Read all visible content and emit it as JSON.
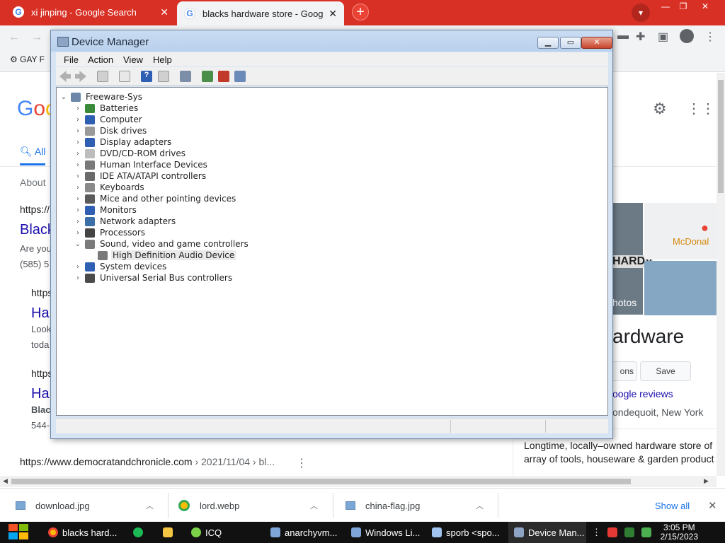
{
  "browser": {
    "tabs": [
      {
        "title": "xi jinping - Google Search",
        "close": "✕"
      },
      {
        "title": "blacks hardware store - Google",
        "close": "✕"
      }
    ],
    "new_tab": "+",
    "bookmark": "GAY F"
  },
  "google": {
    "all_tab": "All",
    "about": "About",
    "result_url_1": "https://",
    "result_title_1": "Black",
    "result_snip_1": "Are you",
    "result_phone_1": "(585) 5",
    "result_url_2": "https",
    "result_title_2": "Ha",
    "result_snip_2a": "Look",
    "result_snip_2b": "toda",
    "result_url_3": "https",
    "result_title_3": "Ha",
    "result_snip_3a": "Black",
    "result_snip_3b": "544-",
    "bottom_url": "https://www.democratandchronicle.com",
    "bottom_path": " › 2021/11/04 › bl...",
    "kp_photos": "hotos",
    "kp_map_label": "McDonal",
    "kp_title": "ardware",
    "kp_btn_directions": "ons",
    "kp_btn_save": "Save",
    "kp_reviews": "oogle reviews",
    "kp_location": "ondequoit, New York",
    "kp_desc_1": "Longtime, locally–owned hardware store of",
    "kp_desc_2": "array of tools, houseware & garden product"
  },
  "downloads": {
    "items": [
      "download.jpg",
      "lord.webp",
      "china-flag.jpg"
    ],
    "show_all": "Show all",
    "close": "✕"
  },
  "device_manager": {
    "title": "Device Manager",
    "menu": [
      "File",
      "Action",
      "View",
      "Help"
    ],
    "root": "Freeware-Sys",
    "categories": [
      {
        "label": "Batteries",
        "icon": "battery-icon",
        "color": "#3a8a3a"
      },
      {
        "label": "Computer",
        "icon": "computer-icon",
        "color": "#2f5fb3"
      },
      {
        "label": "Disk drives",
        "icon": "disk-drive-icon",
        "color": "#9a9a9a"
      },
      {
        "label": "Display adapters",
        "icon": "display-adapter-icon",
        "color": "#2f5fb3"
      },
      {
        "label": "DVD/CD-ROM drives",
        "icon": "dvd-drive-icon",
        "color": "#bdbdbd"
      },
      {
        "label": "Human Interface Devices",
        "icon": "hid-icon",
        "color": "#7a7a7a"
      },
      {
        "label": "IDE ATA/ATAPI controllers",
        "icon": "ide-controller-icon",
        "color": "#6a6a6a"
      },
      {
        "label": "Keyboards",
        "icon": "keyboard-icon",
        "color": "#8a8a8a"
      },
      {
        "label": "Mice and other pointing devices",
        "icon": "mouse-icon",
        "color": "#5a5a5a"
      },
      {
        "label": "Monitors",
        "icon": "monitor-icon",
        "color": "#2f5fb3"
      },
      {
        "label": "Network adapters",
        "icon": "network-adapter-icon",
        "color": "#3b6fa8"
      },
      {
        "label": "Processors",
        "icon": "processor-icon",
        "color": "#444444"
      },
      {
        "label": "Sound, video and game controllers",
        "icon": "speaker-icon",
        "color": "#7a7a7a"
      },
      {
        "label": "High Definition Audio Device",
        "icon": "audio-device-icon",
        "color": "#7a7a7a"
      },
      {
        "label": "System devices",
        "icon": "system-devices-icon",
        "color": "#2f5fb3"
      },
      {
        "label": "Universal Serial Bus controllers",
        "icon": "usb-icon",
        "color": "#4a4a4a"
      }
    ]
  },
  "taskbar": {
    "items": [
      "blacks hard...",
      "ICQ",
      "anarchyvm...",
      "Windows Li...",
      "sporb <spo...",
      "Device Man..."
    ],
    "time": "3:05 PM",
    "date": "2/15/2023"
  }
}
